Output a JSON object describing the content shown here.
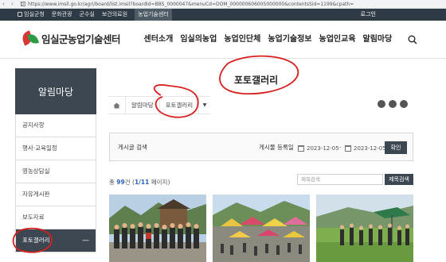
{
  "browser": {
    "url": "https://www.imsil.go.kr/agri/board/list.imsil?boardId=BBS_0000047&menuCd=DOM_000000606005000000&contentsSid=1199&cpath="
  },
  "topbar": {
    "links": [
      {
        "label": "임실군청",
        "icon": "home-icon"
      },
      {
        "label": "문화관광",
        "icon": ""
      },
      {
        "label": "군수실",
        "icon": ""
      },
      {
        "label": "보건의료원",
        "icon": ""
      },
      {
        "label": "농업기술센터",
        "icon": ""
      }
    ],
    "active_index": 4,
    "login_label": "로그인"
  },
  "header": {
    "logo_text": "임실군농업기술센터",
    "nav": [
      "센터소개",
      "임실의농업",
      "농업인단체",
      "농업기술정보",
      "농업인교육",
      "알림마당"
    ]
  },
  "page": {
    "title": "포토갤러리"
  },
  "sidebar": {
    "heading": "알림마당",
    "items": [
      {
        "label": "공지사항"
      },
      {
        "label": "행사·교육일정"
      },
      {
        "label": "영농상담실"
      },
      {
        "label": "자유게시판"
      },
      {
        "label": "보도자료"
      },
      {
        "label": "포토갤러리"
      }
    ],
    "active_index": 5
  },
  "breadcrumb": {
    "items": [
      "알림마당",
      "포토갤러리"
    ]
  },
  "search": {
    "label": "게시글 검색",
    "date_label": "게시물 등록일",
    "date_from": "2023-12-05",
    "separator": "-",
    "date_to": "2023-12-05",
    "confirm_label": "확인"
  },
  "list": {
    "total_prefix": "총 ",
    "total_count": "99",
    "total_suffix": "건",
    "page_open": " (",
    "page_info": "1/11",
    "page_suffix": " 페이지)",
    "keyword_placeholder": "제목검색",
    "keyword_button": "제목검색"
  },
  "colors": {
    "topbar": "#2e3a46",
    "sidebar_dark": "#3d4752",
    "annotation": "#d81f1f",
    "link_blue": "#2b63b8"
  }
}
